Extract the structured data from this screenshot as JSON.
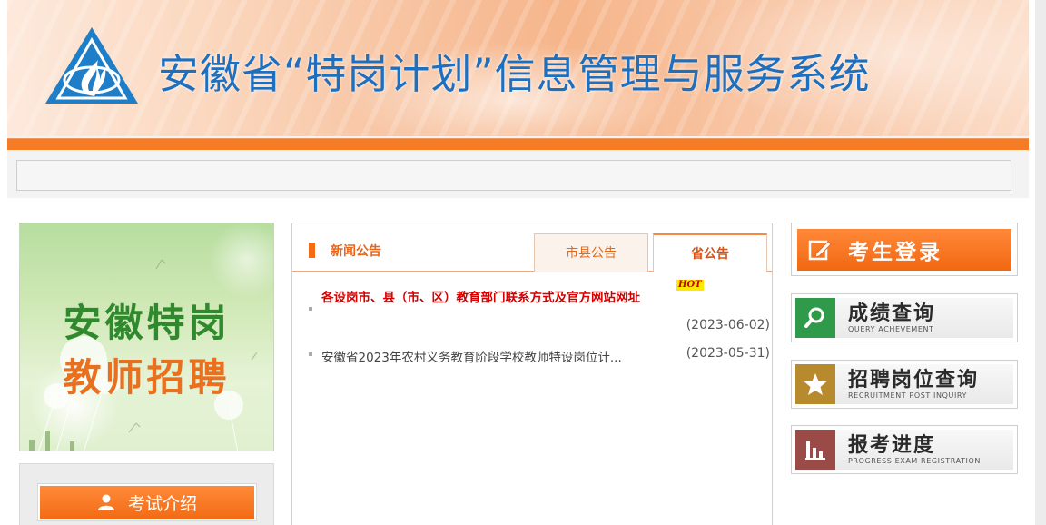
{
  "header": {
    "site_title": "安徽省“特岗计划”信息管理与服务系统"
  },
  "promo": {
    "line1": "安徽特岗",
    "line2": "教师招聘"
  },
  "exam_intro": {
    "label": "考试介绍",
    "icon": "user-icon"
  },
  "news": {
    "heading": "新闻公告",
    "tabs": [
      {
        "label": "市县公告",
        "active": false
      },
      {
        "label": "省公告",
        "active": true
      }
    ],
    "items": [
      {
        "title": "各设岗市、县（市、区）教育部门联系方式及官方网站网址",
        "hot": true,
        "hot_label": "HOT",
        "date": "(2023-06-02)"
      },
      {
        "title": "安徽省2023年农村义务教育阶段学校教师特设岗位计...",
        "hot": false,
        "date": "(2023-05-31)"
      }
    ]
  },
  "sidebar": {
    "login": {
      "label": "考生登录",
      "icon": "edit-icon"
    },
    "features": [
      {
        "cn": "成绩查询",
        "en": "QUERY ACHEVEMENT",
        "icon": "magnifier-icon",
        "color": "#2e9a4a"
      },
      {
        "cn": "招聘岗位查询",
        "en": "RECRUITMENT POST INQUIRY",
        "icon": "star-icon",
        "color": "#b88a2e"
      },
      {
        "cn": "报考进度",
        "en": "PROGRESS EXAM REGISTRATION",
        "icon": "bar-chart-icon",
        "color": "#9a4a47"
      }
    ]
  },
  "colors": {
    "accent": "#f57b24",
    "title_blue": "#1f6fbf",
    "hot_red": "#d40000"
  }
}
